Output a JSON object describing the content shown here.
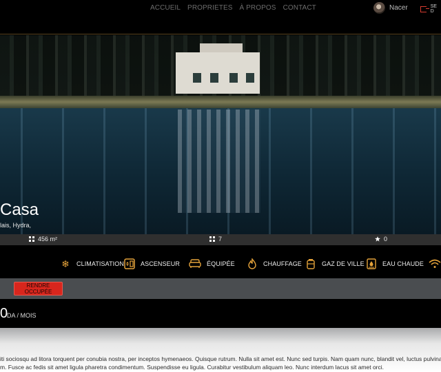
{
  "nav": {
    "items": [
      "ACCUEIL",
      "PROPRIETES",
      "À PROPOS",
      "CONTACT"
    ],
    "user_name": "Nacer",
    "logout_label": "SE D"
  },
  "hero": {
    "title": "Casa",
    "address": "lais, Hydra,"
  },
  "stats": [
    {
      "icon": "grid-icon",
      "value": "456 m²"
    },
    {
      "icon": "grid-icon",
      "value": "7"
    },
    {
      "icon": "star-icon",
      "value": "0"
    }
  ],
  "amenities": [
    {
      "icon": "snowflake-icon",
      "label": "CLIMATISATION"
    },
    {
      "icon": "elevator-icon",
      "label": "ASCENSEUR"
    },
    {
      "icon": "sofa-icon",
      "label": "ÉQUIPÉE"
    },
    {
      "icon": "flame-icon",
      "label": "CHAUFFAGE"
    },
    {
      "icon": "gas-icon",
      "label": "GAZ DE VILLE"
    },
    {
      "icon": "water-heater-icon",
      "label": "EAU CHAUDE"
    },
    {
      "icon": "wifi-icon",
      "label": ""
    }
  ],
  "status": {
    "button_label": "RENDRE OCCUPÉE"
  },
  "price": {
    "amount": "0",
    "unit": "DA / MOIS"
  },
  "description": {
    "line1": "iti sociosqu ad litora torquent per conubia nostra, per inceptos hymenaeos. Quisque rutrum. Nulla sit amet est. Nunc sed turpis. Nam quam nunc, blandit vel, luctus pulvinar,",
    "line2": "m. Fusce ac fedis sit amet ligula pharetra condimentum. Suspendisse eu ligula. Curabitur vestibulum aliquam leo. Nunc interdum lacus sit amet orci."
  },
  "colors": {
    "accent": "#e4a23a",
    "danger": "#d8261d"
  }
}
